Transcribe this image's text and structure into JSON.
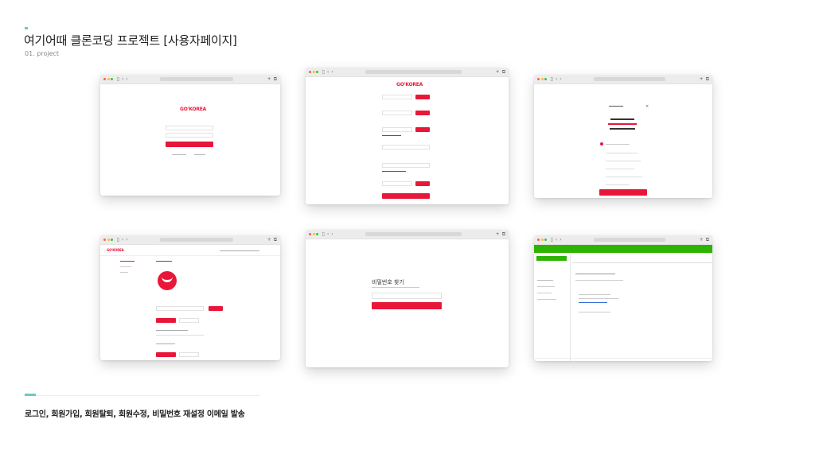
{
  "header": {
    "title": "여기어때 클론코딩 프로젝트 [사용자페이지]",
    "subtitle": "01. project"
  },
  "footer": {
    "caption": "로그인, 회원가입, 회원탈퇴, 회원수정, 비밀번호 재설정 이메일 발송"
  },
  "brand": {
    "logo_text": "GO'KOREA",
    "accent_color": "#e8173a",
    "mail_color": "#2db400",
    "teal_color": "#6fc7c7"
  },
  "screens": {
    "password_reset": {
      "heading": "비밀번호 찾기"
    }
  }
}
